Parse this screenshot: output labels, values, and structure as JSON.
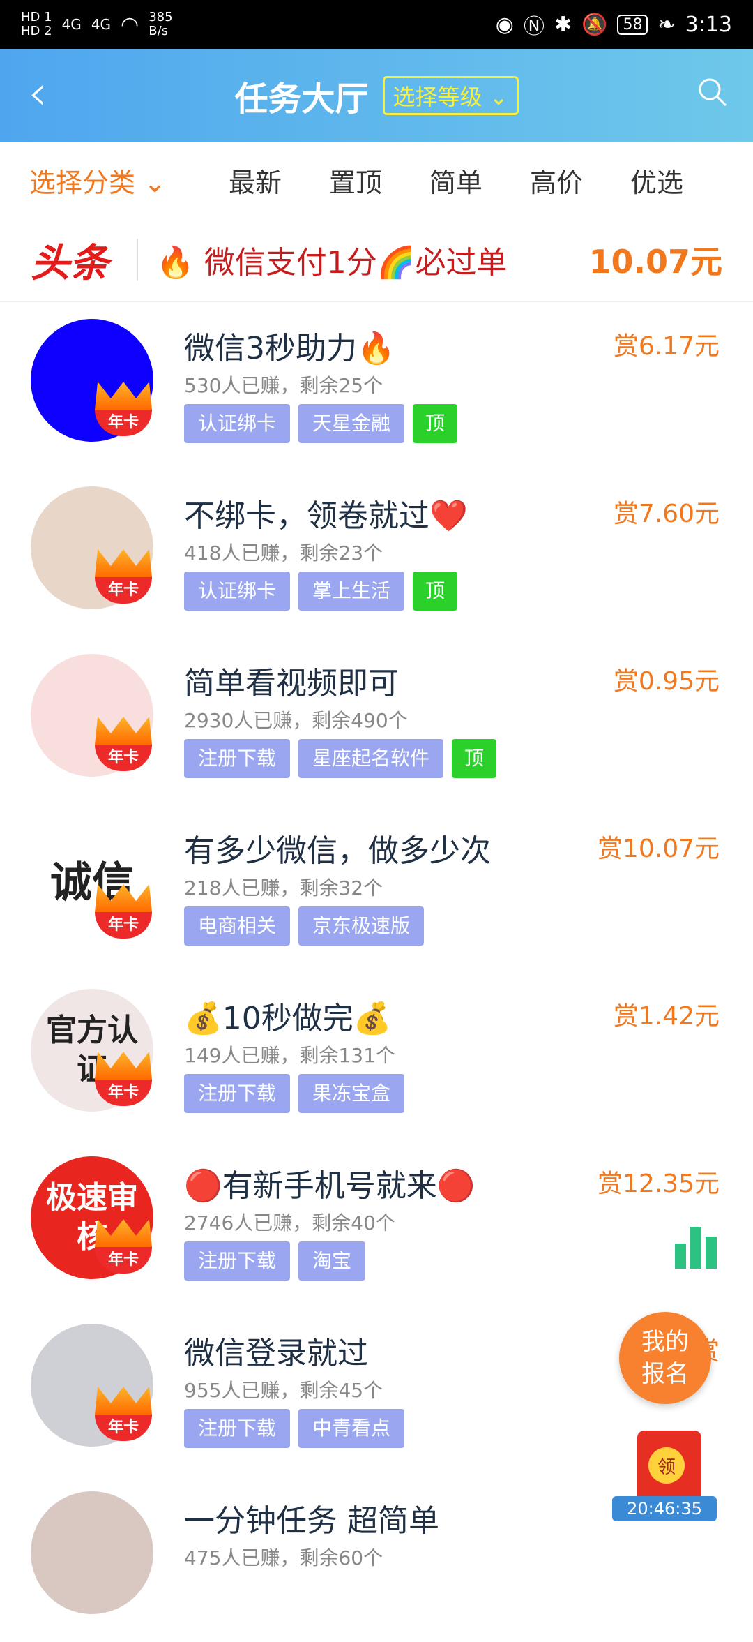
{
  "status_bar": {
    "hd1": "HD 1",
    "hd2": "HD 2",
    "net1": "4G",
    "net2": "4G",
    "speed_top": "385",
    "speed_bottom": "B/s",
    "battery": "58",
    "time": "3:13"
  },
  "header": {
    "title": "任务大厅",
    "level_select": "选择等级"
  },
  "tabs": {
    "category": "选择分类",
    "latest": "最新",
    "pinned": "置顶",
    "simple": "简单",
    "high_price": "高价",
    "featured": "优选"
  },
  "headline": {
    "badge": "头条",
    "text": "🔥 微信支付1分🌈必过单",
    "price": "10.07元"
  },
  "tasks": [
    {
      "title": "微信3秒助力🔥",
      "meta": "530人已赚，剩余25个",
      "tags": [
        "认证绑卡",
        "天星金融"
      ],
      "top": "顶",
      "price": "赏6.17元",
      "avatar_text": "",
      "avatar_color": "#0d00ff",
      "crown": "年卡"
    },
    {
      "title": "不绑卡，领卷就过❤️",
      "meta": "418人已赚，剩余23个",
      "tags": [
        "认证绑卡",
        "掌上生活"
      ],
      "top": "顶",
      "price": "赏7.60元",
      "avatar_text": "",
      "avatar_color": "#e8d6c8",
      "crown": "年卡"
    },
    {
      "title": "简单看视频即可",
      "meta": "2930人已赚，剩余490个",
      "tags": [
        "注册下载",
        "星座起名软件"
      ],
      "top": "顶",
      "price": "赏0.95元",
      "avatar_text": "",
      "avatar_color": "#f9dede",
      "crown": "年卡"
    },
    {
      "title": "有多少微信，做多少次",
      "meta": "218人已赚，剩余32个",
      "tags": [
        "电商相关",
        "京东极速版"
      ],
      "top": "",
      "price": "赏10.07元",
      "avatar_text": "诚信",
      "avatar_color": "#ffffff",
      "crown": "年卡"
    },
    {
      "title": "💰10秒做完💰",
      "meta": "149人已赚，剩余131个",
      "tags": [
        "注册下载",
        "果冻宝盒"
      ],
      "top": "",
      "price": "赏1.42元",
      "avatar_text": "官方认证",
      "avatar_color": "#f1e6e6",
      "crown": "年卡"
    },
    {
      "title": "🔴有新手机号就来🔴",
      "meta": "2746人已赚，剩余40个",
      "tags": [
        "注册下载",
        "淘宝"
      ],
      "top": "",
      "price": "赏12.35元",
      "avatar_text": "极速审核",
      "avatar_color": "#e8251f",
      "crown": "年卡"
    },
    {
      "title": "微信登录就过",
      "meta": "955人已赚，剩余45个",
      "tags": [
        "注册下载",
        "中青看点"
      ],
      "top": "",
      "price": "赏",
      "avatar_text": "",
      "avatar_color": "#cfcfd6",
      "crown": "年卡"
    },
    {
      "title": "一分钟任务 超简单",
      "meta": "475人已赚，剩余60个",
      "tags": [],
      "top": "",
      "price": "",
      "avatar_text": "",
      "avatar_color": "#d9c8c2",
      "crown": ""
    }
  ],
  "floating": {
    "my_signup": "我的报名",
    "redpacket_label": "领",
    "redpacket_time": "20:46:35"
  }
}
